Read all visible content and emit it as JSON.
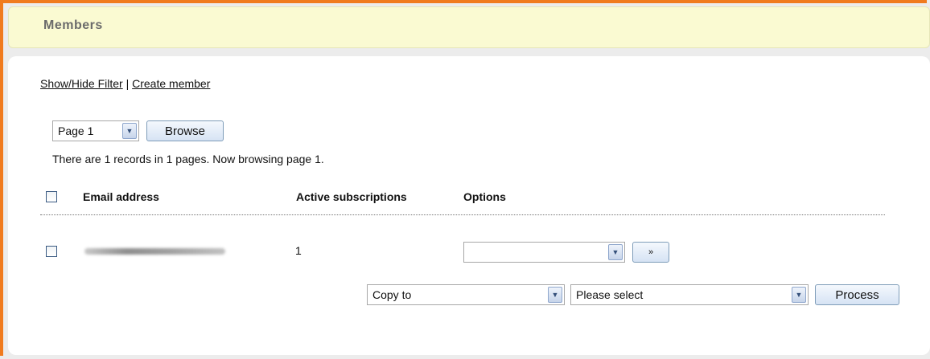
{
  "header": {
    "title": "Members"
  },
  "links": {
    "show_hide_filter": "Show/Hide Filter",
    "separator": "|",
    "create_member": "Create member"
  },
  "pager": {
    "selected_page": "Page 1",
    "browse_label": "Browse",
    "records_text": "There are 1 records in 1 pages. Now browsing page 1."
  },
  "table": {
    "columns": [
      "Email address",
      "Active subscriptions",
      "Options"
    ],
    "rows": [
      {
        "email": "",
        "active_subscriptions": "1",
        "option_selected": "",
        "go_label": "»"
      }
    ]
  },
  "bulk": {
    "action_selected": "Copy to",
    "target_selected": "Please select",
    "process_label": "Process"
  },
  "colors": {
    "accent_border": "#f07b1e",
    "header_bg": "#fafad2"
  }
}
